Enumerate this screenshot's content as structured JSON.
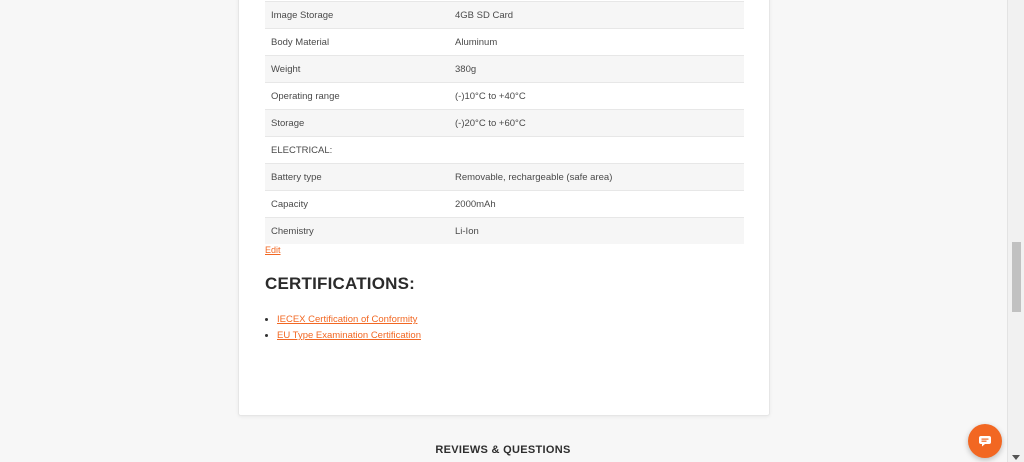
{
  "specs": {
    "rows": [
      {
        "label": "Image Storage",
        "value": "4GB SD Card"
      },
      {
        "label": "Body Material",
        "value": "Aluminum"
      },
      {
        "label": "Weight",
        "value": "380g"
      },
      {
        "label": "Operating range",
        "value": "(-)10°C to +40°C"
      },
      {
        "label": "Storage",
        "value": "(-)20°C to +60°C"
      },
      {
        "label": "ELECTRICAL:",
        "value": ""
      },
      {
        "label": "Battery type",
        "value": "Removable, rechargeable (safe area)"
      },
      {
        "label": "Capacity",
        "value": "2000mAh"
      },
      {
        "label": "Chemistry",
        "value": "Li-Ion"
      }
    ],
    "edit_label": "Edit"
  },
  "certifications": {
    "title": "CERTIFICATIONS:",
    "links": [
      "IECEX Certification of Conformity",
      "EU Type Examination Certification"
    ]
  },
  "reviews": {
    "heading": "REVIEWS & QUESTIONS"
  },
  "chat": {
    "icon": "chat-icon",
    "color": "#f26722"
  },
  "colors": {
    "accent": "#f26722",
    "stripe": "#f6f6f6",
    "background": "#f7f7f7"
  }
}
